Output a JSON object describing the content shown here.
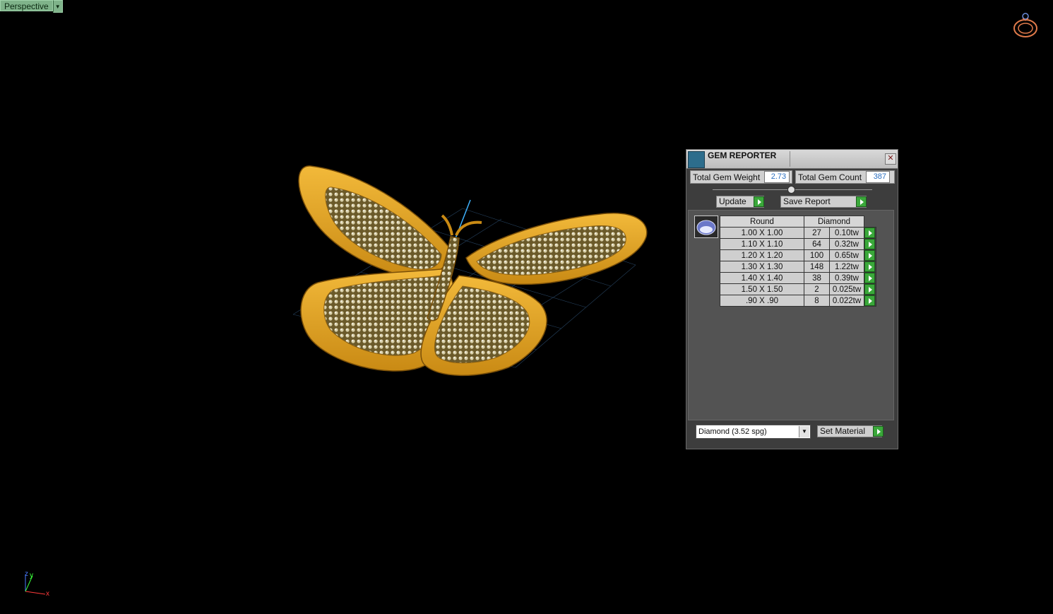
{
  "viewport": {
    "name": "Perspective",
    "dropdown_icon": "triangle-down-icon"
  },
  "view_cube": {
    "icon": "ring-icon"
  },
  "axis_gizmo": {
    "z": "z",
    "y": "y",
    "x": "x"
  },
  "gem_reporter": {
    "title": "GEM REPORTER",
    "total_gem_weight_label": "Total Gem Weight",
    "total_gem_weight": "2.73",
    "total_gem_count_label": "Total Gem Count",
    "total_gem_count": "387",
    "update_label": "Update",
    "save_report_label": "Save Report",
    "table": {
      "header_cut": "Round",
      "header_material": "Diamond",
      "rows": [
        {
          "size": "1.00 X 1.00",
          "count": "27",
          "weight": "0.10tw"
        },
        {
          "size": "1.10 X 1.10",
          "count": "64",
          "weight": "0.32tw"
        },
        {
          "size": "1.20 X 1.20",
          "count": "100",
          "weight": "0.65tw"
        },
        {
          "size": "1.30 X 1.30",
          "count": "148",
          "weight": "1.22tw"
        },
        {
          "size": "1.40 X 1.40",
          "count": "38",
          "weight": "0.39tw"
        },
        {
          "size": "1.50 X 1.50",
          "count": "2",
          "weight": "0.025tw"
        },
        {
          "size": ".90 X .90",
          "count": "8",
          "weight": "0.022tw"
        }
      ]
    },
    "material_select": "Diamond    (3.52 spg)",
    "set_material_label": "Set Material"
  },
  "colors": {
    "gold": "#e3a323",
    "accent_green": "#3aa83a",
    "value_blue": "#2b6fc0",
    "viewport_bg": "#000000"
  }
}
